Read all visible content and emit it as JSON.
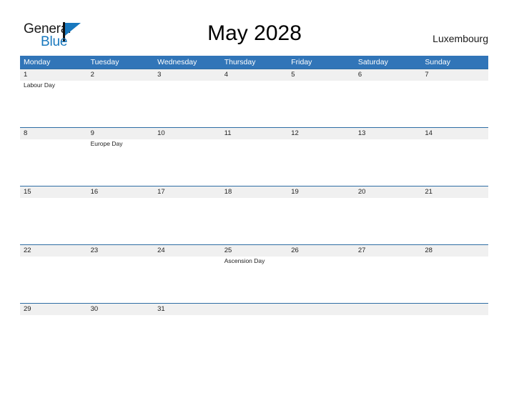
{
  "header": {
    "logo": {
      "word_one": "General",
      "word_two": "Blue",
      "icon": "flag-icon",
      "brand_color": "#1878be"
    },
    "title": "May 2028",
    "location": "Luxembourg"
  },
  "calendar": {
    "header_color": "#3175b8",
    "date_band_color": "#f0f0f0",
    "row_divider_color": "#2e6da4",
    "weekdays": [
      "Monday",
      "Tuesday",
      "Wednesday",
      "Thursday",
      "Friday",
      "Saturday",
      "Sunday"
    ],
    "weeks": [
      [
        {
          "date": "1",
          "event": "Labour Day"
        },
        {
          "date": "2",
          "event": ""
        },
        {
          "date": "3",
          "event": ""
        },
        {
          "date": "4",
          "event": ""
        },
        {
          "date": "5",
          "event": ""
        },
        {
          "date": "6",
          "event": ""
        },
        {
          "date": "7",
          "event": ""
        }
      ],
      [
        {
          "date": "8",
          "event": ""
        },
        {
          "date": "9",
          "event": "Europe Day"
        },
        {
          "date": "10",
          "event": ""
        },
        {
          "date": "11",
          "event": ""
        },
        {
          "date": "12",
          "event": ""
        },
        {
          "date": "13",
          "event": ""
        },
        {
          "date": "14",
          "event": ""
        }
      ],
      [
        {
          "date": "15",
          "event": ""
        },
        {
          "date": "16",
          "event": ""
        },
        {
          "date": "17",
          "event": ""
        },
        {
          "date": "18",
          "event": ""
        },
        {
          "date": "19",
          "event": ""
        },
        {
          "date": "20",
          "event": ""
        },
        {
          "date": "21",
          "event": ""
        }
      ],
      [
        {
          "date": "22",
          "event": ""
        },
        {
          "date": "23",
          "event": ""
        },
        {
          "date": "24",
          "event": ""
        },
        {
          "date": "25",
          "event": "Ascension Day"
        },
        {
          "date": "26",
          "event": ""
        },
        {
          "date": "27",
          "event": ""
        },
        {
          "date": "28",
          "event": ""
        }
      ],
      [
        {
          "date": "29",
          "event": ""
        },
        {
          "date": "30",
          "event": ""
        },
        {
          "date": "31",
          "event": ""
        },
        {
          "date": "",
          "event": ""
        },
        {
          "date": "",
          "event": ""
        },
        {
          "date": "",
          "event": ""
        },
        {
          "date": "",
          "event": ""
        }
      ]
    ]
  }
}
